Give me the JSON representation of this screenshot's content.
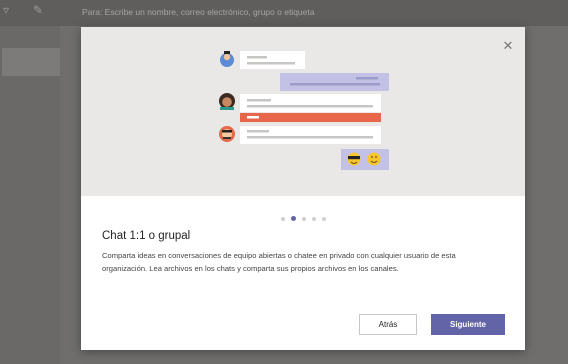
{
  "header": {
    "to_label": "Para:  Escribe un nombre, correo electrónico, grupo o etiqueta",
    "icons": [
      "filter-icon",
      "compose-icon"
    ]
  },
  "dialog": {
    "close_icon": "close-icon",
    "title": "Chat 1:1 o grupal",
    "description": "Comparta ideas en conversaciones de equipo abiertas o chatee en privado con cualquier usuario de esta organización. Lea archivos en los chats y comparta sus propios archivos en los canales.",
    "pager": {
      "total": 5,
      "active_index": 1
    },
    "buttons": {
      "back": "Atrás",
      "next": "Siguiente"
    }
  },
  "colors": {
    "accent": "#6264a7",
    "illustration_bg": "#e9e8e7",
    "highlight_bar": "#e8664a",
    "emoji_bubble": "#c3c1e6"
  }
}
